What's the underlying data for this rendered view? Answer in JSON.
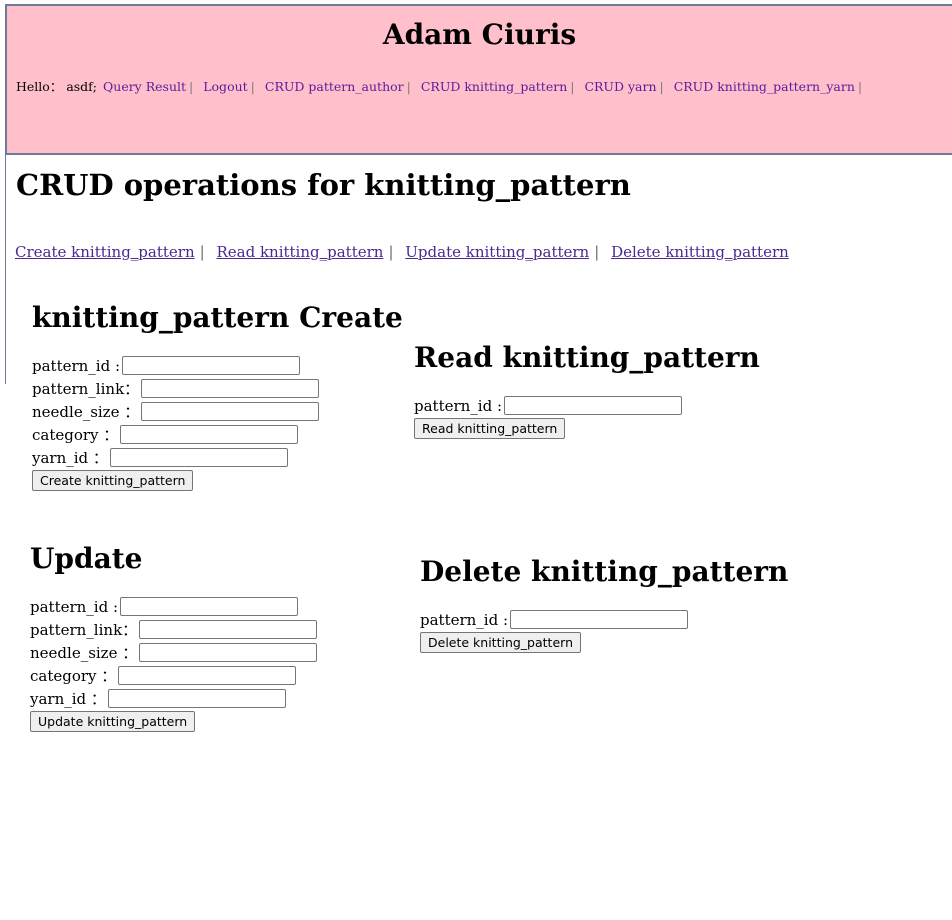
{
  "header": {
    "title": "Adam Ciuris",
    "hello_label": "Hello：",
    "username": "asdf;",
    "links": [
      "Query Result",
      "Logout",
      "CRUD pattern_author",
      "CRUD knitting_pattern",
      "CRUD yarn",
      "CRUD knitting_pattern_yarn"
    ],
    "separator": "|"
  },
  "page": {
    "title": "CRUD operations for knitting_pattern",
    "crud_links": [
      "Create knitting_pattern",
      "Read knitting_pattern",
      "Update knitting_pattern",
      "Delete knitting_pattern"
    ],
    "separator": "|"
  },
  "create": {
    "heading": "knitting_pattern Create",
    "labels": [
      "pattern_id :",
      "pattern_link：",
      "needle_size ：",
      "category ：",
      "yarn_id ："
    ],
    "values": [
      "",
      "",
      "",
      "",
      ""
    ],
    "button": "Create knitting_pattern"
  },
  "read": {
    "heading": "Read knitting_pattern",
    "label": "pattern_id :",
    "value": "",
    "button": "Read knitting_pattern"
  },
  "update": {
    "heading": "Update",
    "labels": [
      "pattern_id :",
      "pattern_link：",
      "needle_size ：",
      "category ：",
      "yarn_id ："
    ],
    "values": [
      "",
      "",
      "",
      "",
      ""
    ],
    "button": "Update knitting_pattern"
  },
  "delete": {
    "heading": "Delete knitting_pattern",
    "label": "pattern_id :",
    "value": "",
    "button": "Delete knitting_pattern"
  },
  "colors": {
    "header_bg": "#ffc0cb",
    "header_border": "#6d7d97",
    "link": "#4b2a8f"
  }
}
